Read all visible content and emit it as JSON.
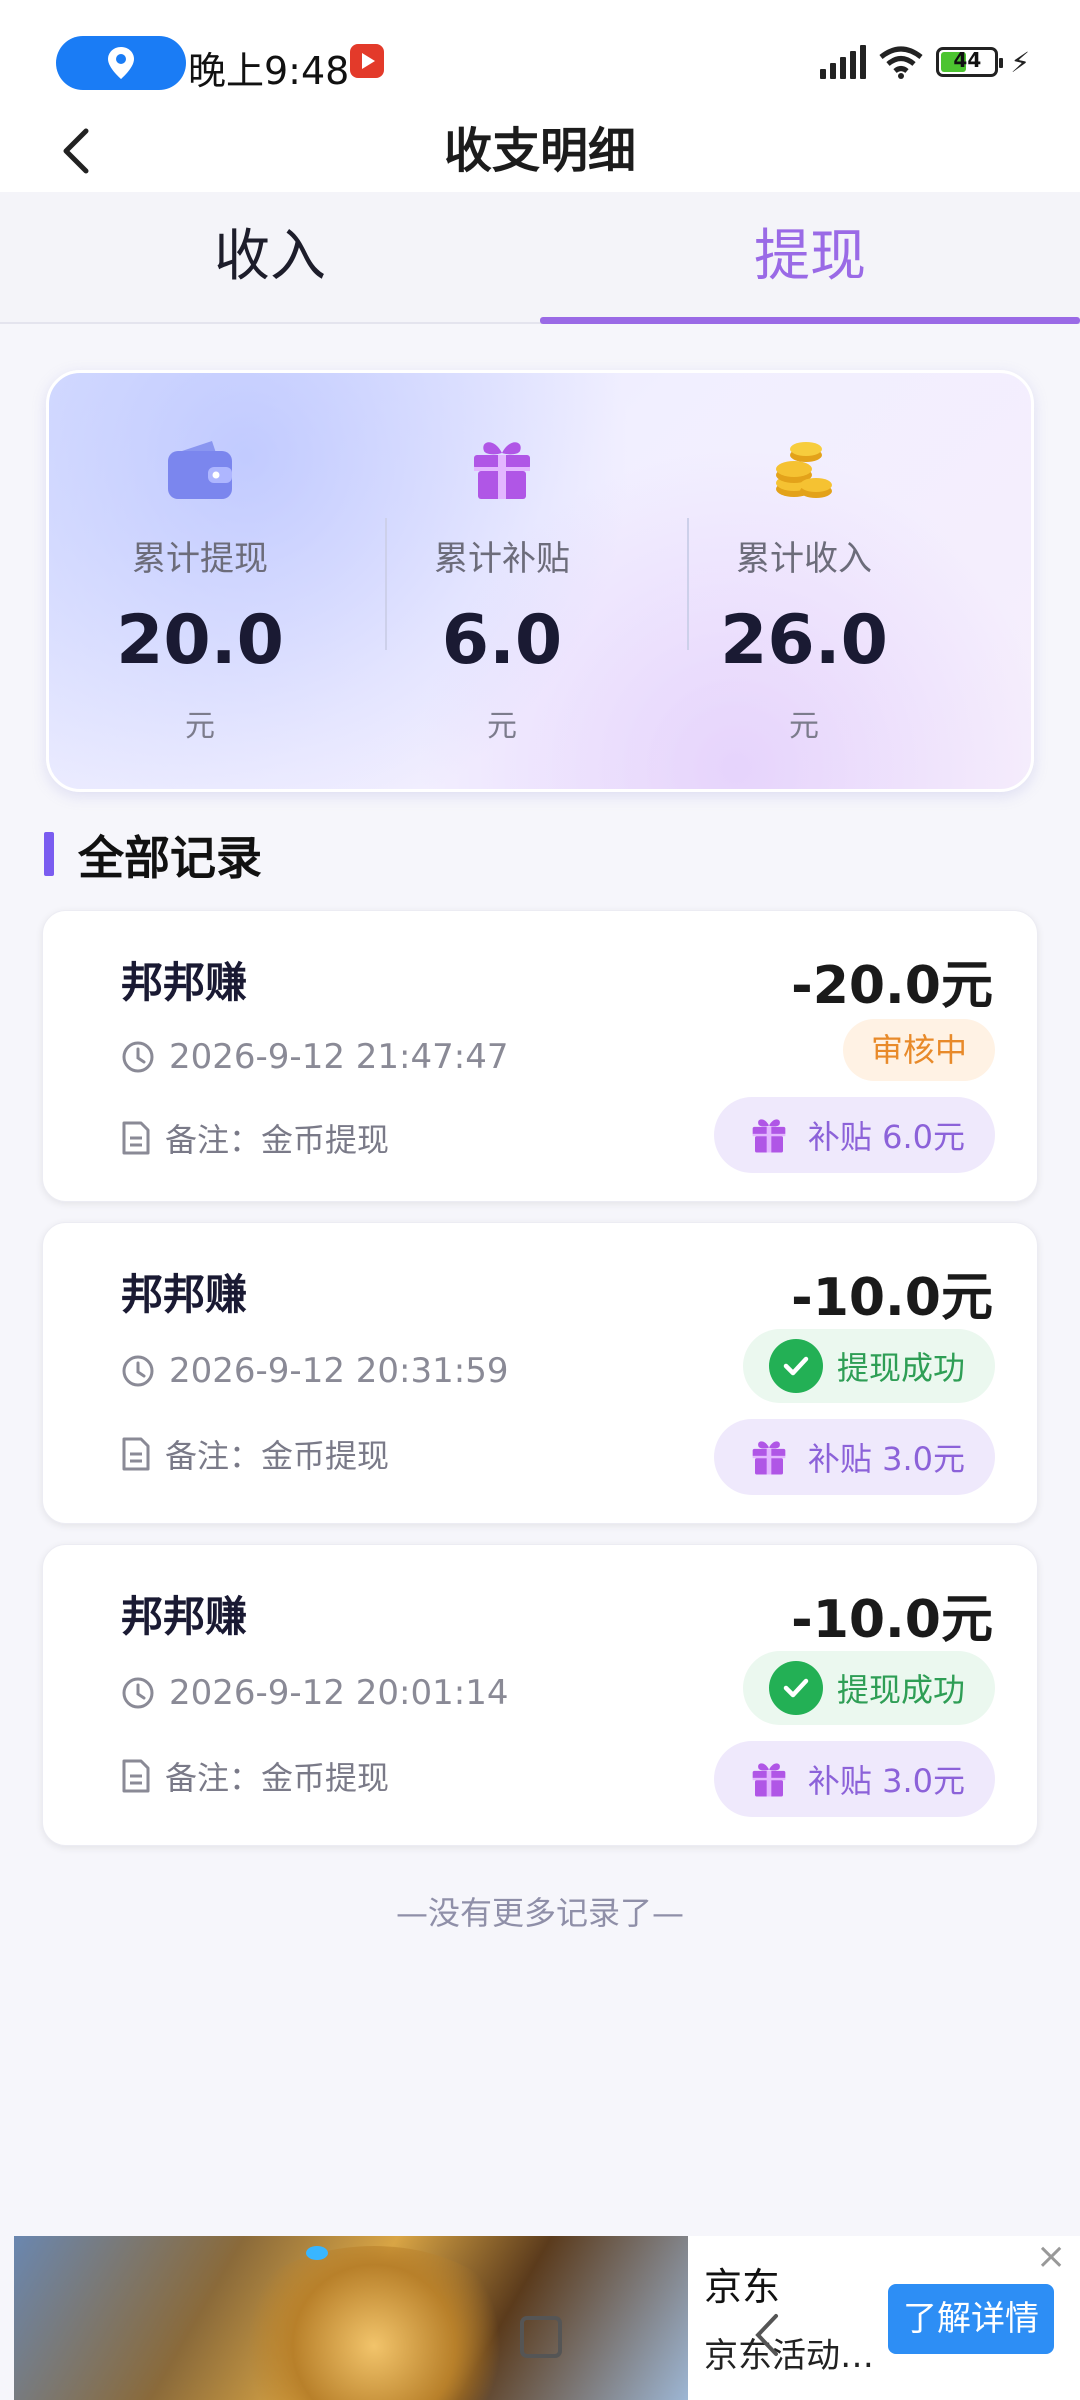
{
  "status_bar": {
    "time": "晚上9:48",
    "battery": "44"
  },
  "header": {
    "title": "收支明细"
  },
  "tabs": [
    {
      "label": "收入"
    },
    {
      "label": "提现"
    }
  ],
  "active_tab": "提现",
  "summary": {
    "stats": [
      {
        "label": "累计提现",
        "value": "20.0",
        "unit": "元",
        "icon": "wallet-icon"
      },
      {
        "label": "累计补贴",
        "value": "6.0",
        "unit": "元",
        "icon": "gift-icon"
      },
      {
        "label": "累计收入",
        "value": "26.0",
        "unit": "元",
        "icon": "coins-icon"
      }
    ]
  },
  "section": {
    "title": "全部记录"
  },
  "records": [
    {
      "name": "邦邦赚",
      "amount": "-20.0元",
      "time": "2026-9-12 21:47:47",
      "note": "备注：金币提现",
      "status": "审核中",
      "subsidy": "补贴 6.0元"
    },
    {
      "name": "邦邦赚",
      "amount": "-10.0元",
      "time": "2026-9-12 20:31:59",
      "note": "备注：金币提现",
      "status": "提现成功",
      "subsidy": "补贴 3.0元"
    },
    {
      "name": "邦邦赚",
      "amount": "-10.0元",
      "time": "2026-9-12 20:01:14",
      "note": "备注：金币提现",
      "status": "提现成功",
      "subsidy": "补贴 3.0元"
    }
  ],
  "footer": {
    "no_more": "—没有更多记录了—"
  },
  "ad": {
    "brand": "京东",
    "desc": "京东活动…",
    "cta": "了解详情",
    "close": "×"
  },
  "colors": {
    "accent": "#9a6ae6",
    "success": "#23b055",
    "review": "#e88a2a",
    "subsidy": "#8c62d9"
  }
}
